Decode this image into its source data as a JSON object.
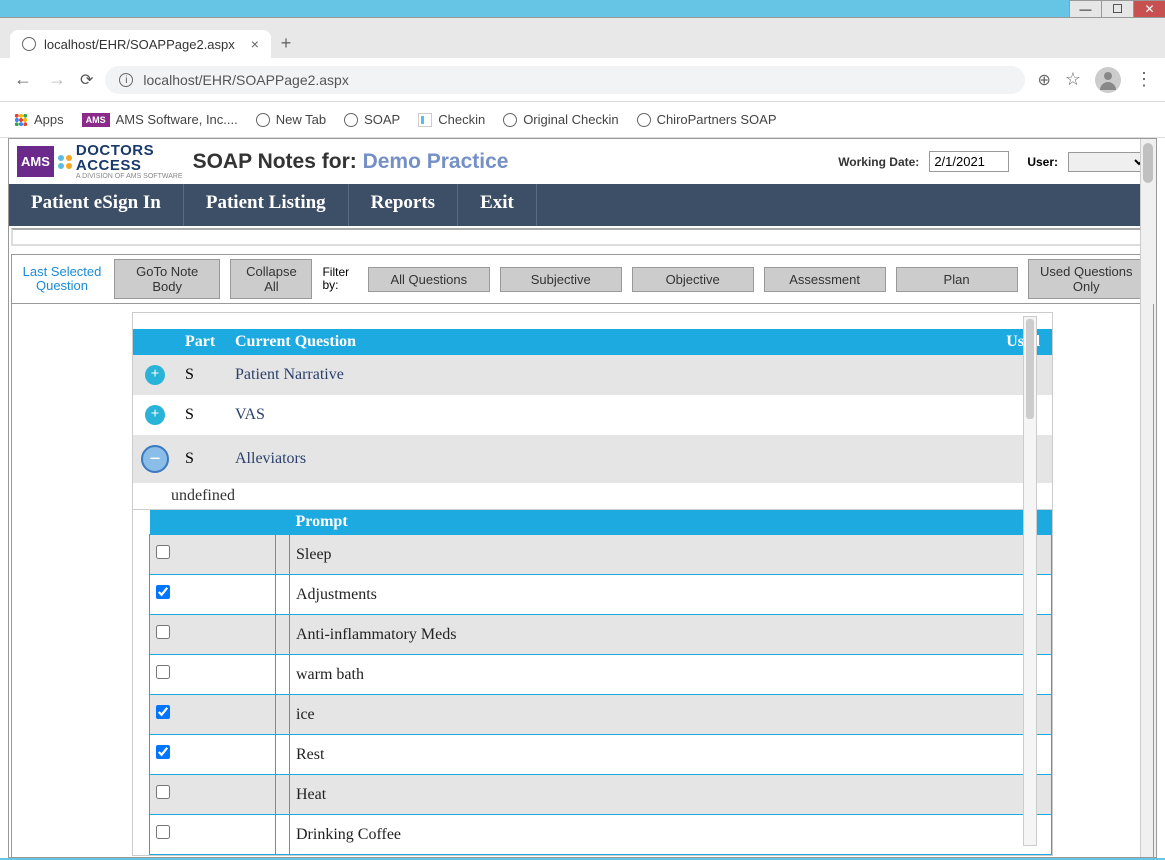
{
  "browser": {
    "tab_title": "localhost/EHR/SOAPPage2.aspx",
    "url": "localhost/EHR/SOAPPage2.aspx",
    "bookmarks": {
      "apps": "Apps",
      "ams": "AMS Software, Inc....",
      "newtab": "New Tab",
      "soap": "SOAP",
      "checkin": "Checkin",
      "original": "Original Checkin",
      "chiro": "ChiroPartners SOAP"
    }
  },
  "header": {
    "title_prefix": "SOAP Notes for:",
    "title_practice": "Demo Practice",
    "working_date_label": "Working Date:",
    "working_date": "2/1/2021",
    "user_label": "User:",
    "logo_brand": "AMS",
    "logo_line1": "DOCTORS",
    "logo_line2": "ACCESS",
    "logo_sub": "A DIVISION OF AMS SOFTWARE"
  },
  "nav": {
    "esign": "Patient eSign In",
    "listing": "Patient Listing",
    "reports": "Reports",
    "exit": "Exit"
  },
  "toolbar": {
    "last_selected": "Last Selected Question",
    "goto": "GoTo Note Body",
    "collapse": "Collapse All",
    "filter_by": "Filter by:",
    "all_q": "All Questions",
    "subjective": "Subjective",
    "objective": "Objective",
    "assessment": "Assessment",
    "plan": "Plan",
    "used_only": "Used Questions Only"
  },
  "qheader": {
    "part": "Part",
    "current": "Current Question",
    "used": "Used"
  },
  "questions": [
    {
      "part": "S",
      "text": "Patient Narrative",
      "toggle": "plus",
      "alt": true
    },
    {
      "part": "S",
      "text": "VAS",
      "toggle": "plus",
      "alt": false
    },
    {
      "part": "S",
      "text": "Alleviators",
      "toggle": "minus",
      "alt": true
    }
  ],
  "undefined_text": "undefined",
  "prompt_header": "Prompt",
  "prompts": [
    {
      "label": "Sleep",
      "checked": false,
      "alt": true
    },
    {
      "label": "Adjustments",
      "checked": true,
      "alt": false
    },
    {
      "label": "Anti-inflammatory Meds",
      "checked": false,
      "alt": true
    },
    {
      "label": "warm bath",
      "checked": false,
      "alt": false
    },
    {
      "label": "ice",
      "checked": true,
      "alt": true
    },
    {
      "label": "Rest",
      "checked": true,
      "alt": false
    },
    {
      "label": "Heat",
      "checked": false,
      "alt": true
    },
    {
      "label": "Drinking Coffee",
      "checked": false,
      "alt": false
    }
  ]
}
